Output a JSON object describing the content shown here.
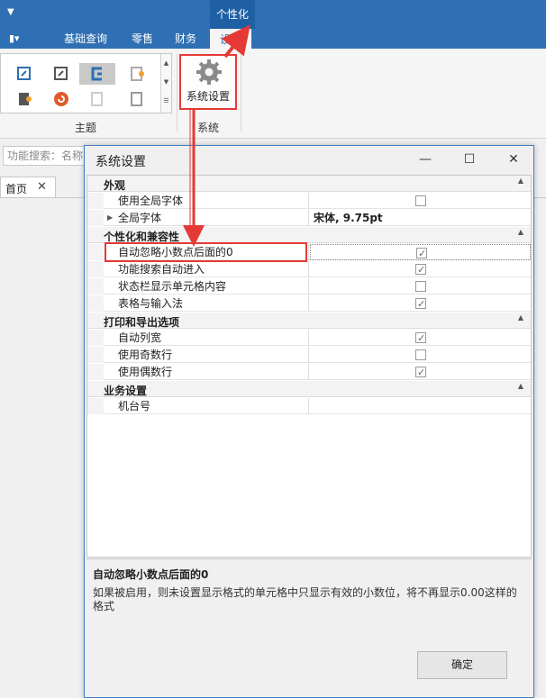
{
  "ribbon": {
    "qat_symbol": "▼",
    "contextual_tab": "个性化",
    "menu_symbol": "▮▾",
    "tabs": [
      {
        "label": "基础查询"
      },
      {
        "label": "零售"
      },
      {
        "label": "财务"
      },
      {
        "label": "设置"
      }
    ],
    "theme_group_label": "主题",
    "system_group_label": "系统",
    "system_settings_label": "系统设置"
  },
  "left": {
    "search_placeholder": "功能搜索：名称",
    "doc_tab": "首页",
    "close_symbol": "✕"
  },
  "dialog": {
    "title": "系统设置",
    "controls": {
      "minimize": "—",
      "maximize": "☐",
      "close": "✕"
    },
    "categories": [
      {
        "title": "外观"
      },
      {
        "title": "个性化和兼容性"
      },
      {
        "title": "打印和导出选项"
      },
      {
        "title": "业务设置"
      }
    ],
    "rows": {
      "use_global_font": {
        "label": "使用全局字体",
        "checked": false
      },
      "global_font": {
        "label": "全局字体",
        "value": "宋体, 9.75pt"
      },
      "auto_ignore_zero": {
        "label": "自动忽略小数点后面的0",
        "checked": true
      },
      "func_search_auto": {
        "label": "功能搜索自动进入",
        "checked": true
      },
      "statusbar_cell": {
        "label": "状态栏显示单元格内容",
        "checked": false
      },
      "table_input": {
        "label": "表格与输入法",
        "checked": true
      },
      "auto_col_width": {
        "label": "自动列宽",
        "checked": true
      },
      "odd_rows": {
        "label": "使用奇数行",
        "checked": false
      },
      "even_rows": {
        "label": "使用偶数行",
        "checked": true
      },
      "terminal_no": {
        "label": "机台号",
        "value": ""
      }
    },
    "description_title": "自动忽略小数点后面的0",
    "description_text": "如果被启用，则未设置显示格式的单元格中只显示有效的小数位，将不再显示0.00这样的格式",
    "ok_label": "确定"
  },
  "colors": {
    "accent": "#2f6fb3",
    "highlight": "#e53935"
  }
}
